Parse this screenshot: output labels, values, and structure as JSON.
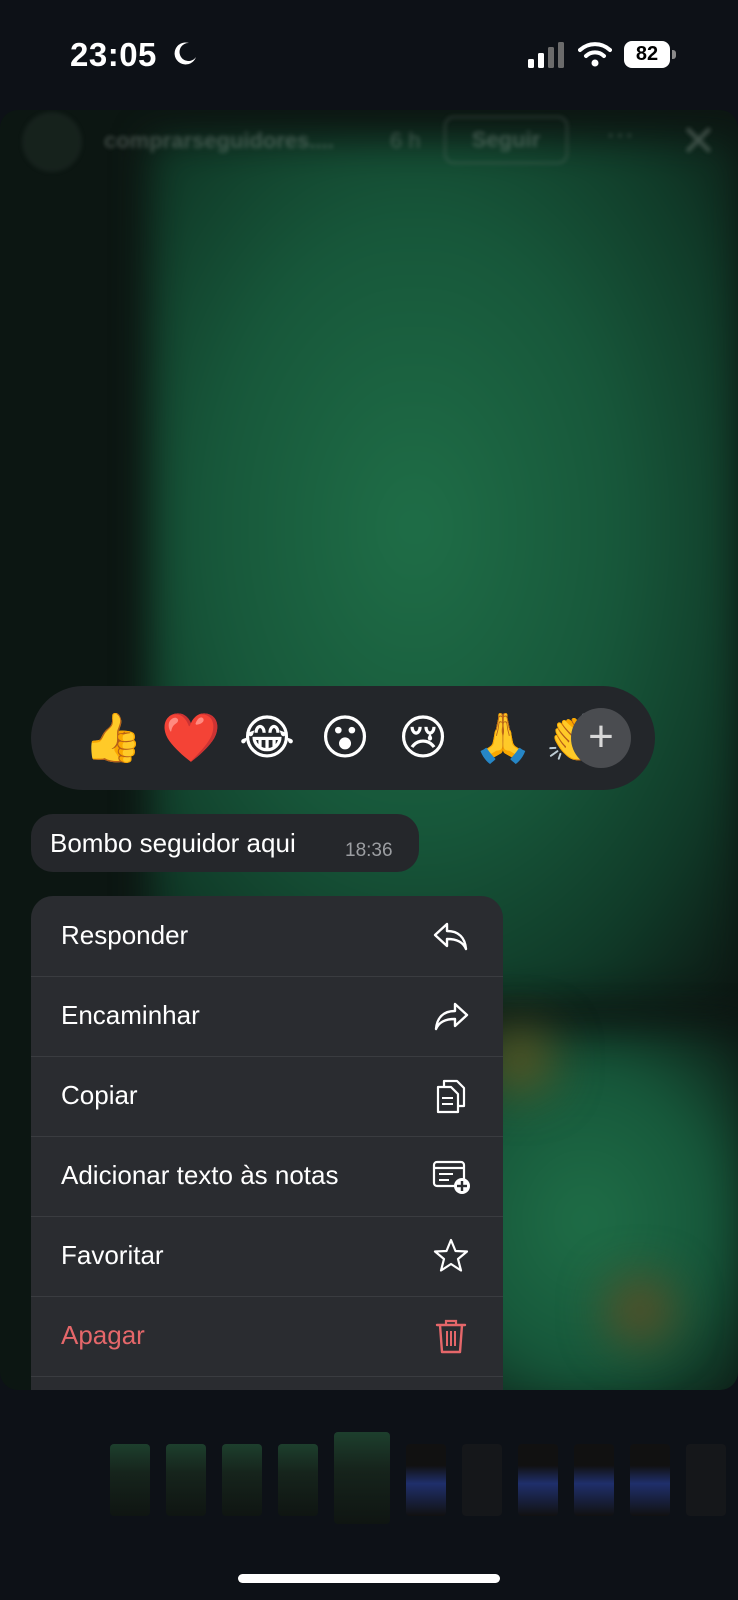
{
  "status_bar": {
    "time": "23:05",
    "battery": "82"
  },
  "story": {
    "username": "comprarseguidores....",
    "age": "6 h",
    "follow_label": "Seguir",
    "more_label": "···",
    "close_label": "✕"
  },
  "reactions": [
    "👍",
    "❤️",
    "😂",
    "😮",
    "😢",
    "🙏",
    "👏"
  ],
  "reaction_more_label": "+",
  "message": {
    "text": "Bombo seguidor aqui",
    "time": "18:36"
  },
  "menu": {
    "items": [
      {
        "label": "Responder",
        "icon": "reply-icon"
      },
      {
        "label": "Encaminhar",
        "icon": "forward-icon"
      },
      {
        "label": "Copiar",
        "icon": "copy-icon"
      },
      {
        "label": "Adicionar texto às notas",
        "icon": "add-note-icon"
      },
      {
        "label": "Favoritar",
        "icon": "star-icon"
      },
      {
        "label": "Apagar",
        "icon": "trash-icon",
        "color": "#e5676a"
      }
    ]
  }
}
